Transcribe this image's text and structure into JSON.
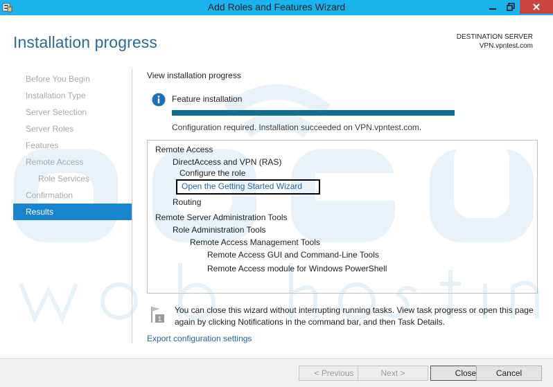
{
  "window": {
    "title": "Add Roles and Features Wizard",
    "icon": "server-manager-icon"
  },
  "header": {
    "page_title": "Installation progress",
    "destination_label": "DESTINATION SERVER",
    "destination_value": "VPN.vpntest.com"
  },
  "nav": {
    "items": [
      {
        "label": "Before You Begin"
      },
      {
        "label": "Installation Type"
      },
      {
        "label": "Server Selection"
      },
      {
        "label": "Server Roles"
      },
      {
        "label": "Features"
      },
      {
        "label": "Remote Access"
      },
      {
        "label": "Role Services"
      },
      {
        "label": "Confirmation"
      },
      {
        "label": "Results"
      }
    ]
  },
  "main": {
    "view_label": "View installation progress",
    "feature_label": "Feature installation",
    "progress": 1.0,
    "status": "Configuration required. Installation succeeded on VPN.vpntest.com.",
    "tree": [
      "Remote Access",
      "DirectAccess and VPN (RAS)",
      "Configure the role",
      "Open the Getting Started Wizard",
      "Routing",
      "Remote Server Administration Tools",
      "Role Administration Tools",
      "Remote Access Management Tools",
      "Remote Access GUI and Command-Line Tools",
      "Remote Access module for Windows PowerShell"
    ],
    "note": "You can close this wizard without interrupting running tasks. View task progress or open this page again by clicking Notifications in the command bar, and then Task Details.",
    "flag_badge": "1",
    "export_link": "Export configuration settings"
  },
  "buttons": {
    "previous": "< Previous",
    "next": "Next >",
    "close": "Close",
    "cancel": "Cancel"
  },
  "colors": {
    "titlebar": "#1ab3ee",
    "accent": "#1a84cf",
    "title_text": "#2b6a9b",
    "progress": "#0f6e8f",
    "link": "#2363a5"
  }
}
